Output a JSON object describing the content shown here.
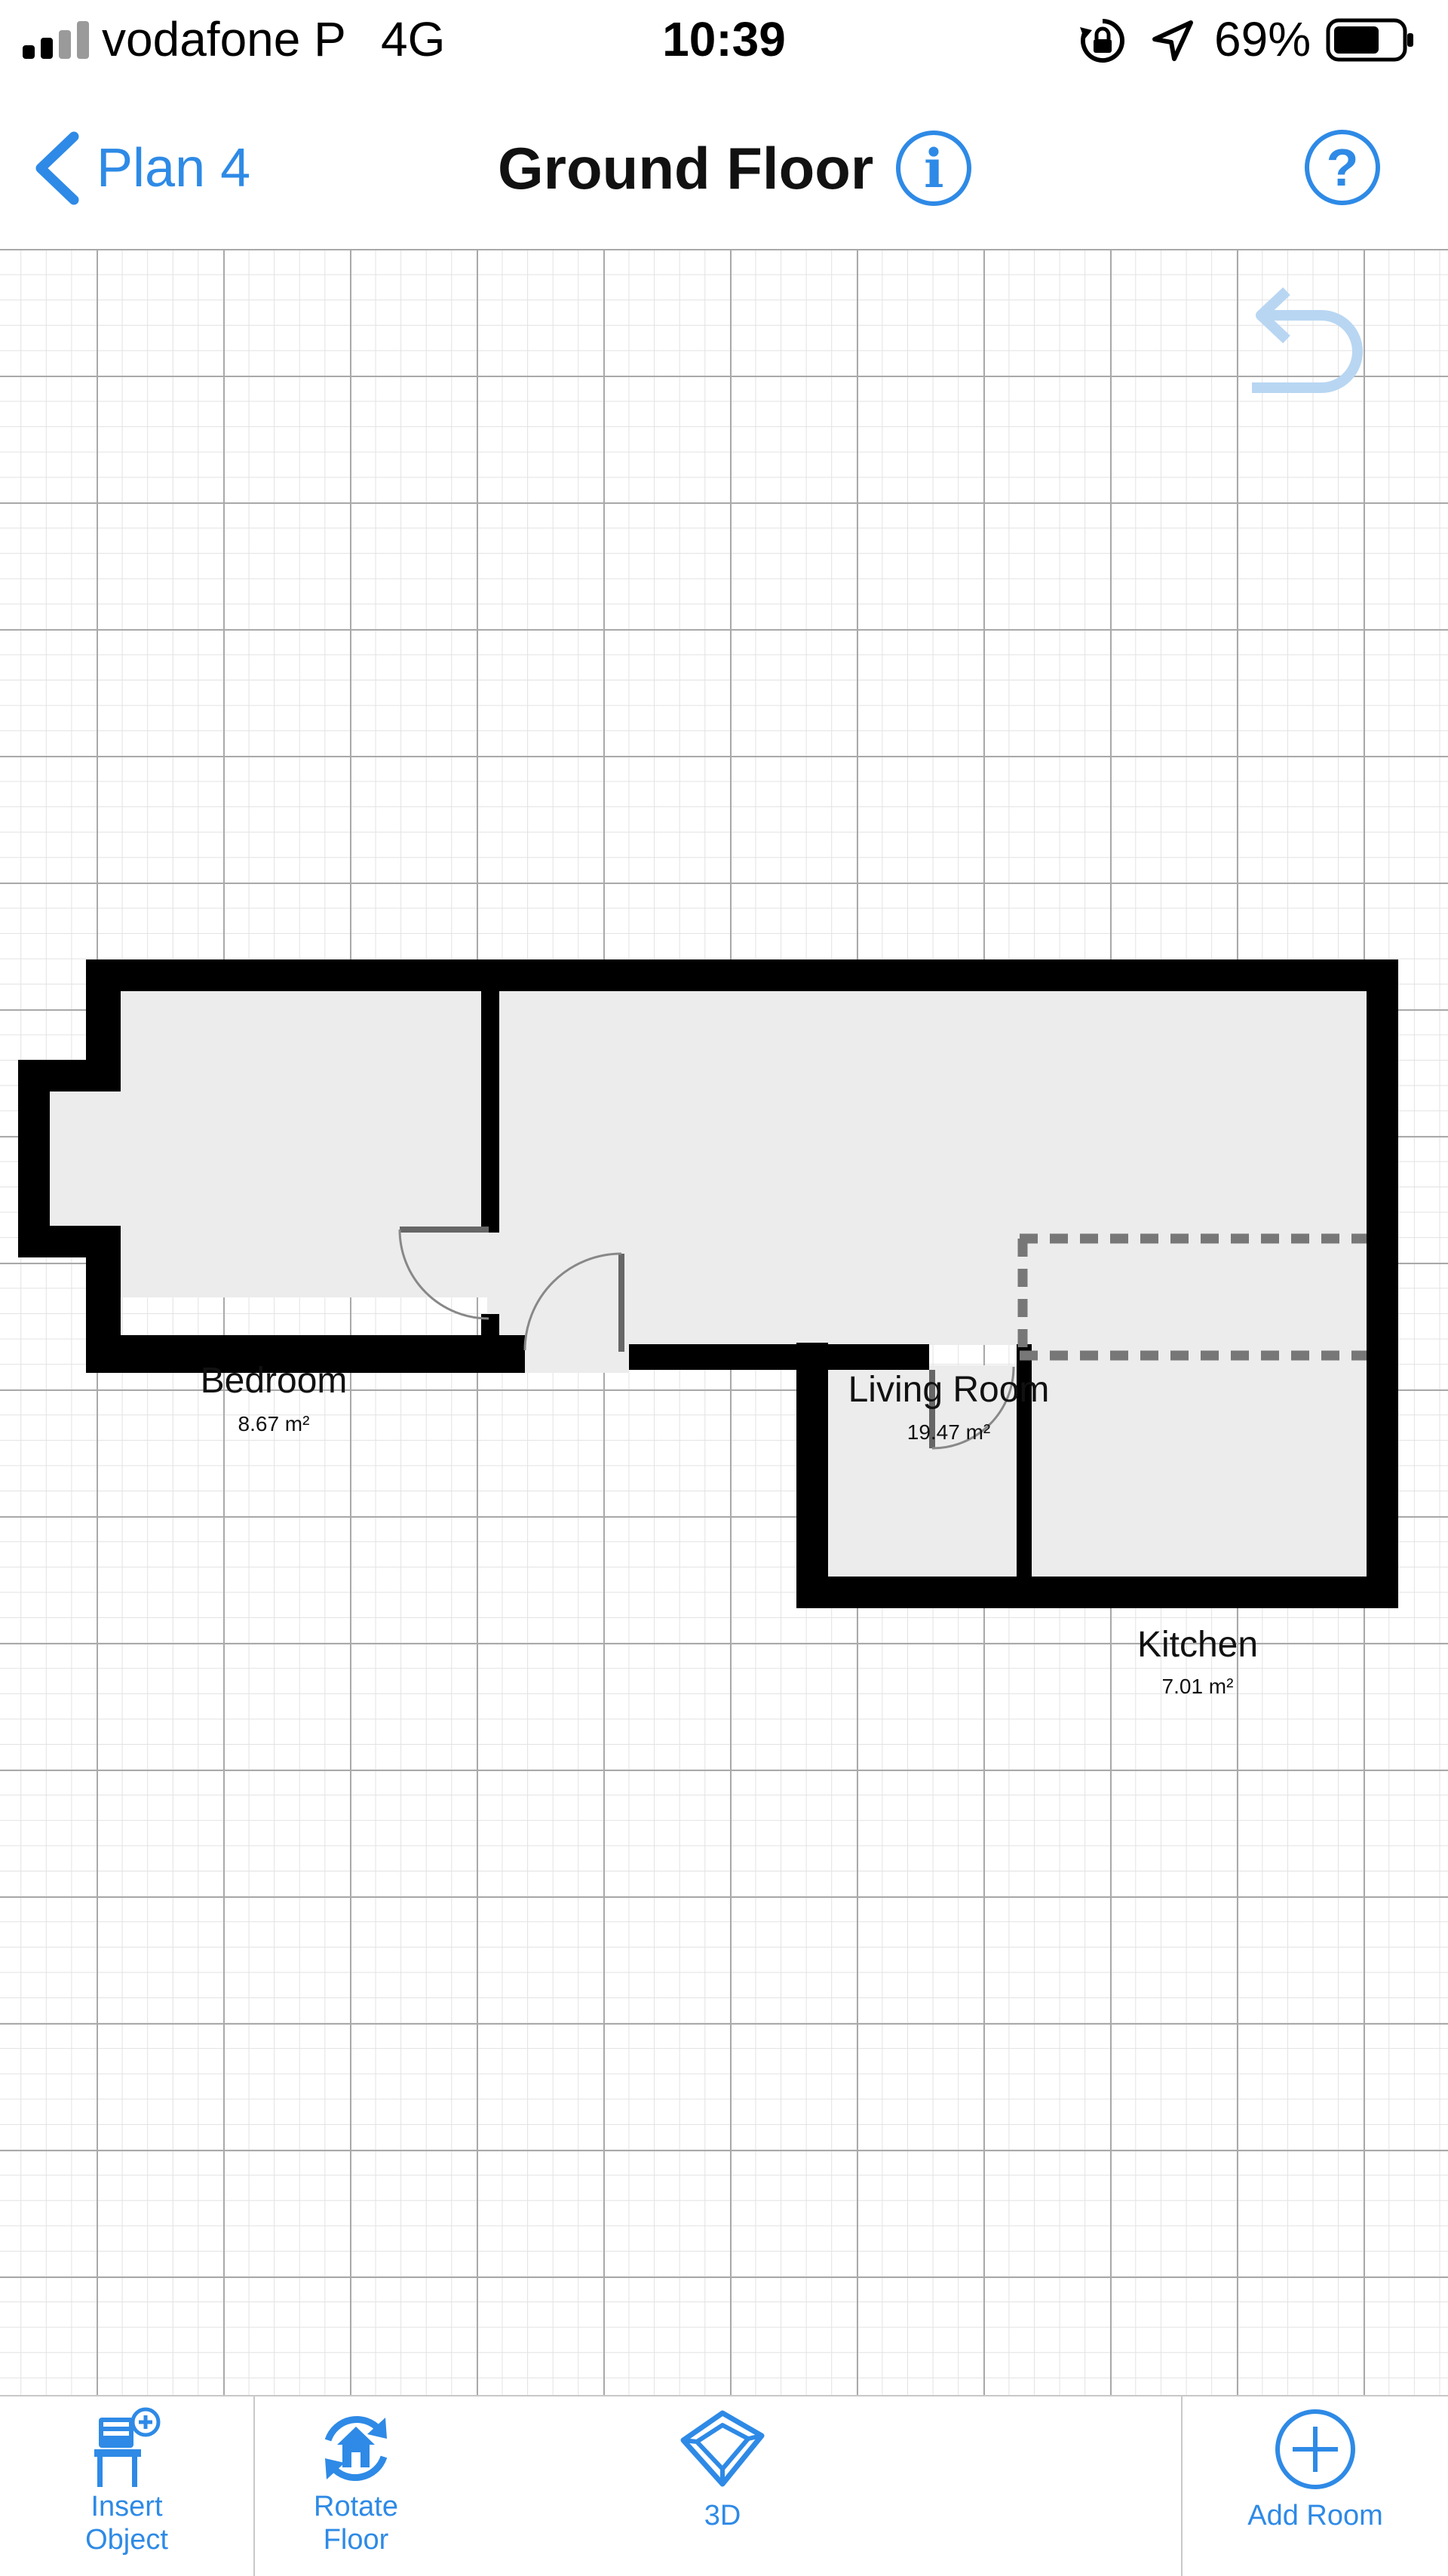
{
  "status_bar": {
    "carrier": "vodafone P",
    "network": "4G",
    "time": "10:39",
    "battery_percent": "69%",
    "battery_level": 0.69,
    "signal_bars_active": 2,
    "signal_bars_total": 4
  },
  "nav": {
    "back_label": "Plan 4",
    "title": "Ground Floor",
    "info_symbol": "i",
    "help_symbol": "?"
  },
  "canvas": {
    "rooms": [
      {
        "name": "Bedroom",
        "area": "8.67 m²"
      },
      {
        "name": "Living Room",
        "area": "19.47 m²"
      },
      {
        "name": "Kitchen",
        "area": "7.01 m²"
      }
    ]
  },
  "toolbar": {
    "items": [
      {
        "label": "Insert\nObject",
        "icon": "chair-plus-icon"
      },
      {
        "label": "Rotate\nFloor",
        "icon": "rotate-house-icon"
      },
      {
        "label": "3D",
        "icon": "cube-3d-icon"
      },
      {
        "label": "Add Room",
        "icon": "plus-circle-icon"
      }
    ]
  },
  "colors": {
    "accent": "#2e8ae6",
    "wall": "#000000",
    "room_fill": "#ececec",
    "grid_major": "#a9a9a9",
    "grid_minor": "#e2e2e2"
  }
}
